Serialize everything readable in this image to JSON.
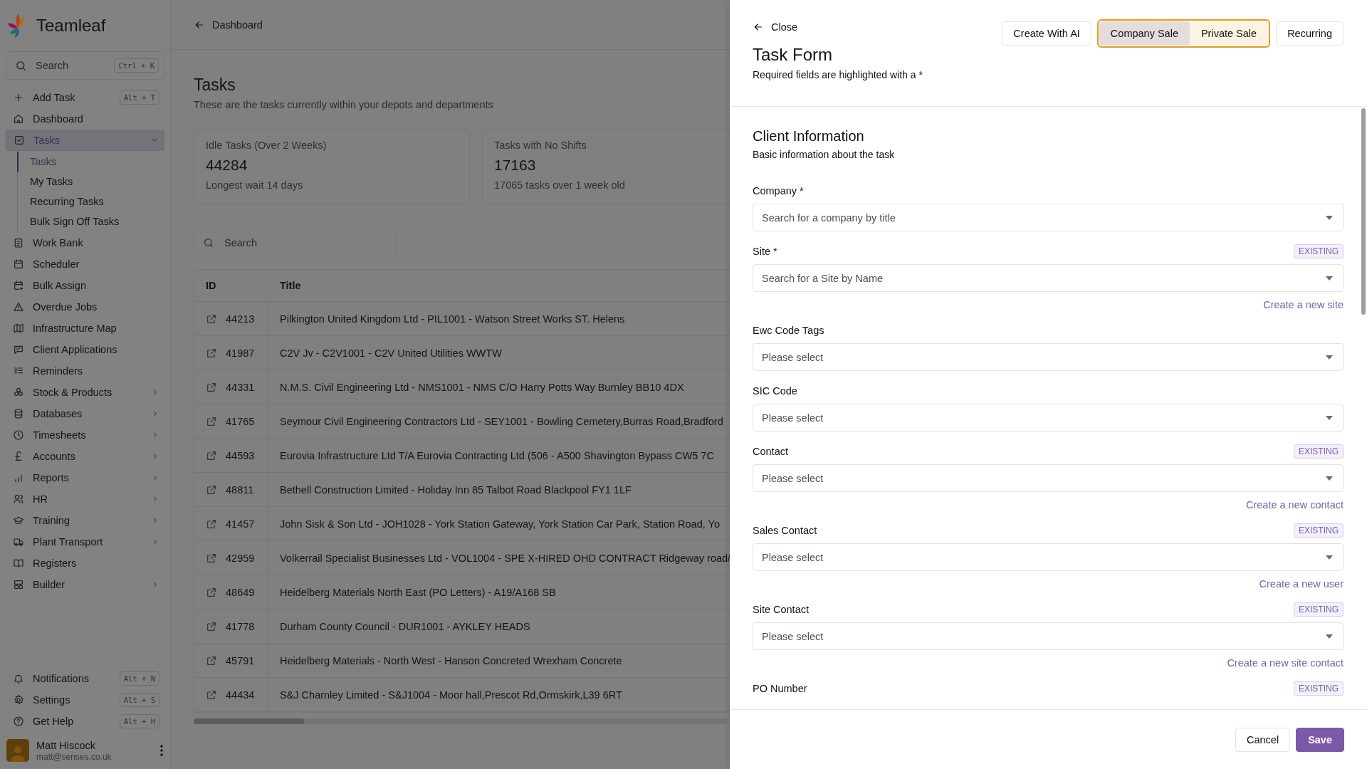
{
  "sidebar": {
    "brand": "Teamleaf",
    "search": {
      "placeholder": "Search",
      "shortcut": "Ctrl + K"
    },
    "items": [
      {
        "label": "Add Task",
        "shortcut": "Alt + T",
        "selected": false,
        "expandable": false,
        "expanded": false
      },
      {
        "label": "Dashboard",
        "selected": false,
        "expandable": false,
        "expanded": false
      },
      {
        "label": "Tasks",
        "selected": true,
        "expandable": true,
        "expanded": true,
        "children": [
          {
            "label": "Tasks",
            "selected": true
          },
          {
            "label": "My Tasks",
            "selected": false
          },
          {
            "label": "Recurring Tasks",
            "selected": false
          },
          {
            "label": "Bulk Sign Off Tasks",
            "selected": false
          }
        ]
      },
      {
        "label": "Work Bank",
        "selected": false,
        "expandable": false,
        "expanded": false
      },
      {
        "label": "Scheduler",
        "selected": false,
        "expandable": false,
        "expanded": false
      },
      {
        "label": "Bulk Assign",
        "selected": false,
        "expandable": false,
        "expanded": false
      },
      {
        "label": "Overdue Jobs",
        "selected": false,
        "expandable": false,
        "expanded": false
      },
      {
        "label": "Infrastructure Map",
        "selected": false,
        "expandable": false,
        "expanded": false
      },
      {
        "label": "Client Applications",
        "selected": false,
        "expandable": false,
        "expanded": false
      },
      {
        "label": "Reminders",
        "selected": false,
        "expandable": false,
        "expanded": false
      },
      {
        "label": "Stock & Products",
        "selected": false,
        "expandable": true,
        "expanded": false
      },
      {
        "label": "Databases",
        "selected": false,
        "expandable": true,
        "expanded": false
      },
      {
        "label": "Timesheets",
        "selected": false,
        "expandable": true,
        "expanded": false
      },
      {
        "label": "Accounts",
        "selected": false,
        "expandable": true,
        "expanded": false
      },
      {
        "label": "Reports",
        "selected": false,
        "expandable": true,
        "expanded": false
      },
      {
        "label": "HR",
        "selected": false,
        "expandable": true,
        "expanded": false
      },
      {
        "label": "Training",
        "selected": false,
        "expandable": true,
        "expanded": false
      },
      {
        "label": "Plant Transport",
        "selected": false,
        "expandable": true,
        "expanded": false
      },
      {
        "label": "Registers",
        "selected": false,
        "expandable": false,
        "expanded": false
      },
      {
        "label": "Builder",
        "selected": false,
        "expandable": true,
        "expanded": false
      }
    ],
    "footer_items": [
      {
        "label": "Notifications",
        "shortcut": "Alt + N"
      },
      {
        "label": "Settings",
        "shortcut": "Alt + S"
      },
      {
        "label": "Get Help",
        "shortcut": "Alt + H"
      }
    ],
    "user": {
      "name": "Matt Hiscock",
      "email": "matt@senses.co.uk"
    }
  },
  "main": {
    "back_link": "Dashboard",
    "title": "Tasks",
    "subtitle": "These are the tasks currently within your depots and departments",
    "stats": [
      {
        "label": "Idle Tasks (Over 2 Weeks)",
        "value": "44284",
        "note": "Longest wait 14 days"
      },
      {
        "label": "Tasks with No Shifts",
        "value": "17163",
        "note": "17065 tasks over 1 week old"
      }
    ],
    "search": {
      "placeholder": "Search"
    },
    "table": {
      "columns": [
        "ID",
        "Title"
      ],
      "rows": [
        {
          "id": "44213",
          "title": "Pilkington United Kingdom Ltd - PIL1001 - Watson Street Works ST. Helens"
        },
        {
          "id": "41987",
          "title": "C2V Jv - C2V1001 - C2V United Utilities WWTW"
        },
        {
          "id": "44331",
          "title": "N.M.S. Civil Engineering Ltd - NMS1001 - NMS C/O Harry Potts Way Burnley BB10 4DX"
        },
        {
          "id": "41765",
          "title": "Seymour Civil Engineering Contractors Ltd - SEY1001 - Bowling Cemetery,Burras Road,Bradford"
        },
        {
          "id": "44593",
          "title": "Eurovia Infrastructure Ltd T/A Eurovia Contracting Ltd (506 - A500 Shavington Bypass CW5 7C"
        },
        {
          "id": "48811",
          "title": "Bethell Construction Limited - Holiday Inn 85 Talbot Road Blackpool FY1 1LF"
        },
        {
          "id": "41457",
          "title": "John Sisk & Son Ltd - JOH1028 - York Station Gateway, York Station Car Park, Station Road, Yo"
        },
        {
          "id": "42959",
          "title": "Volkerrail Specialist Businesses Ltd - VOL1004 - SPE X-HIRED OHD CONTRACT Ridgeway road/"
        },
        {
          "id": "48649",
          "title": "Heidelberg Materials North East (PO Letters) - A19/A168 SB"
        },
        {
          "id": "41778",
          "title": "Durham County Council - DUR1001 - AYKLEY HEADS"
        },
        {
          "id": "45791",
          "title": "Heidelberg Materials - North West - Hanson Concreted Wrexham Concrete"
        },
        {
          "id": "44434",
          "title": "S&J Charnley Limited - S&J1004 - Moor hall,Prescot Rd,Ormskirk,L39 6RT"
        }
      ]
    }
  },
  "panel": {
    "close": "Close",
    "title": "Task Form",
    "subtitle": "Required fields are highlighted with a *",
    "ai_button": "Create With AI",
    "sale_types": [
      {
        "label": "Company Sale",
        "selected": true
      },
      {
        "label": "Private Sale",
        "selected": false
      }
    ],
    "recurring_button": "Recurring",
    "section": {
      "title": "Client Information",
      "subtitle": "Basic information about the task",
      "fields": [
        {
          "label": "Company *",
          "placeholder": "Search for a company by title"
        },
        {
          "label": "Site *",
          "badge": "EXISTING",
          "placeholder": "Search for a Site by Name",
          "link": "Create a new site"
        },
        {
          "label": "Ewc Code Tags",
          "placeholder": "Please select"
        },
        {
          "label": "SIC Code",
          "placeholder": "Please select"
        },
        {
          "label": "Contact",
          "badge": "EXISTING",
          "placeholder": "Please select",
          "link": "Create a new contact"
        },
        {
          "label": "Sales Contact",
          "badge": "EXISTING",
          "placeholder": "Please select",
          "link": "Create a new user"
        },
        {
          "label": "Site Contact",
          "badge": "EXISTING",
          "placeholder": "Please select",
          "link": "Create a new site contact"
        },
        {
          "label": "PO Number",
          "badge": "EXISTING"
        }
      ]
    },
    "cancel_button": "Cancel",
    "save_button": "Save"
  }
}
